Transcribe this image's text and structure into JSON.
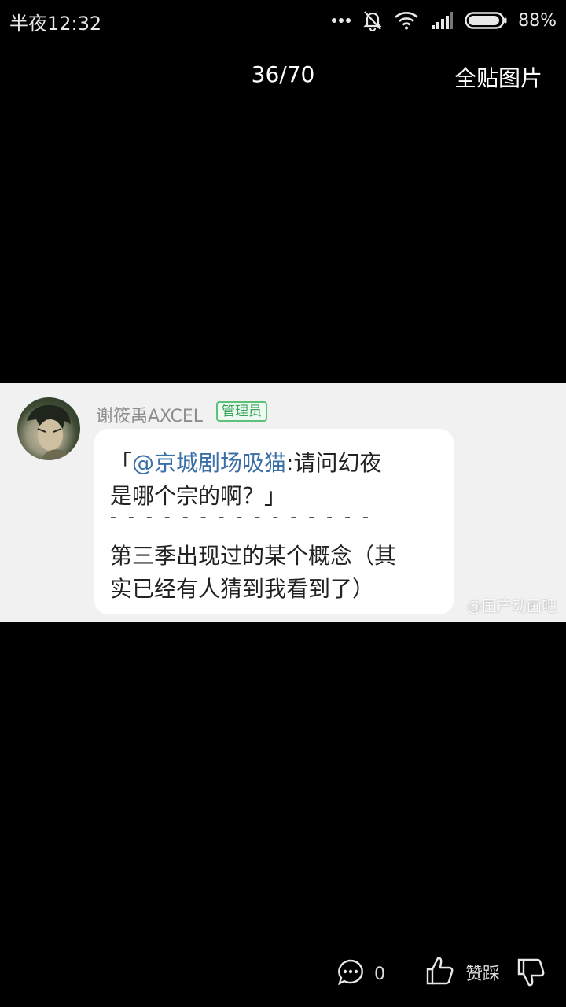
{
  "status_bar": {
    "time": "半夜12:32",
    "battery": "88%"
  },
  "viewer": {
    "page_counter": "36/70",
    "all_images_label": "全贴图片"
  },
  "post_image": {
    "username": "谢筱禹AXCEL",
    "badge": "管理员",
    "quote_open": "「",
    "mention": "@京城剧场吸猫",
    "quote_rest": ":请问幻夜",
    "quote_line2": "是哪个宗的啊？」",
    "divider": "- - - - - - - - - - - - - - -",
    "reply_line1": "第三季出现过的某个概念（其",
    "reply_line2": "实已经有人猜到我看到了）",
    "watermark": "@国产动画吧"
  },
  "bottom_bar": {
    "comment_count": "0",
    "like_label": "赞踩"
  },
  "colors": {
    "background": "#000000",
    "mention": "#3a6fa8",
    "badge": "#3aa55a"
  }
}
